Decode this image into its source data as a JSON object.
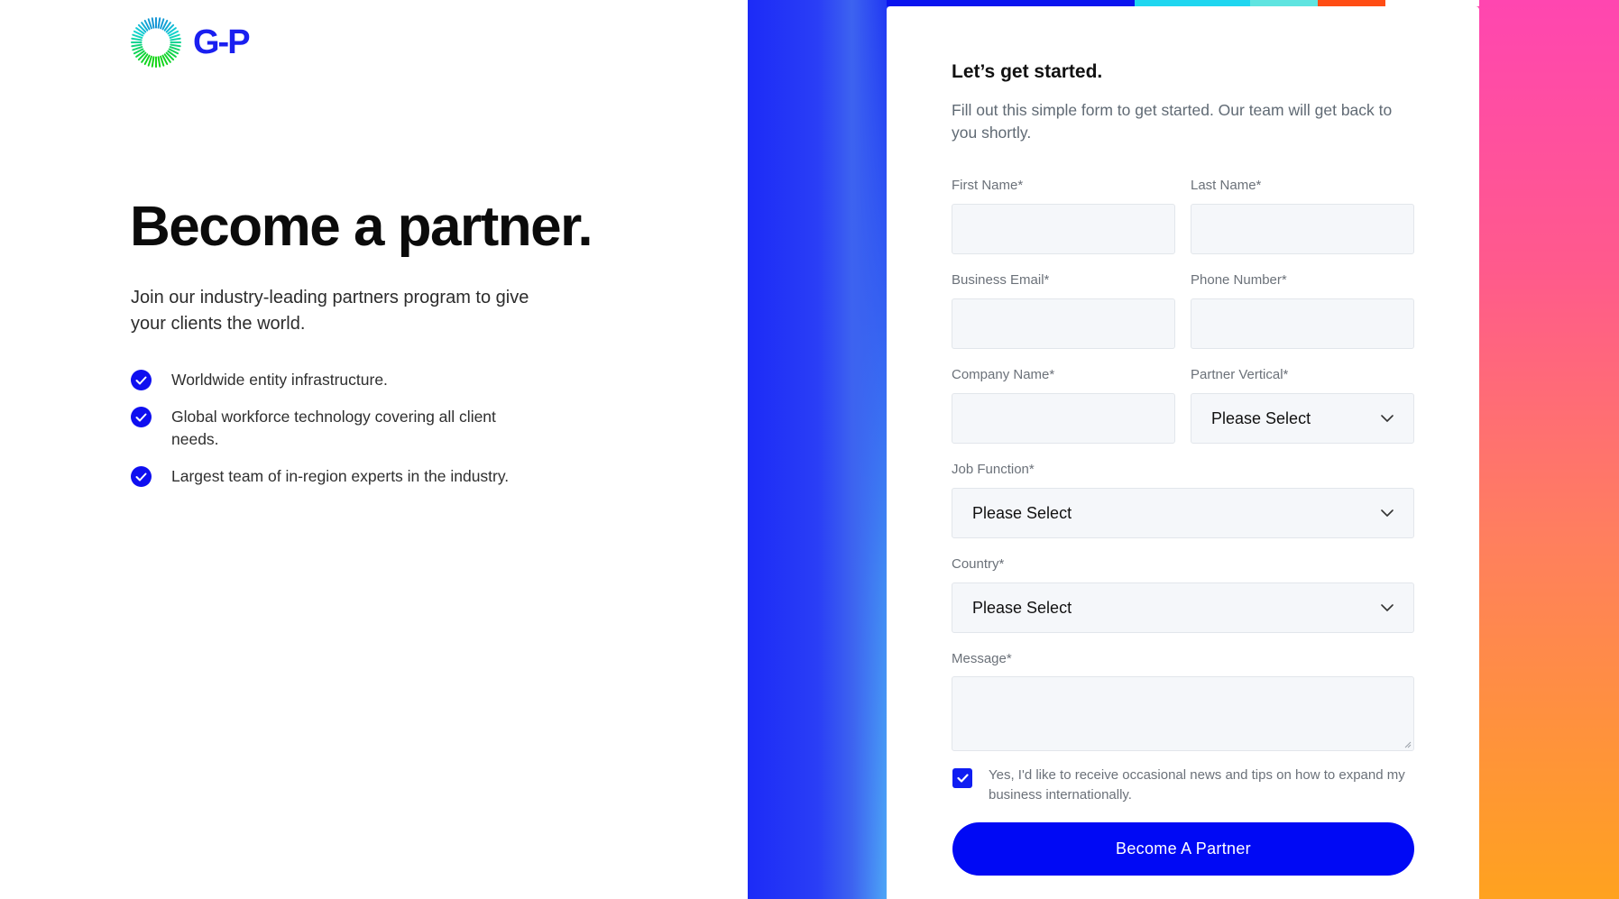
{
  "brand": {
    "logo_text": "G-P",
    "accent_color": "#0f0ff0",
    "button_color": "#0009f5"
  },
  "hero": {
    "headline": "Become a partner.",
    "intro": "Join our industry-leading partners program to give your clients the world.",
    "benefits": [
      "Worldwide entity infrastructure.",
      "Global workforce technology covering all client needs.",
      "Largest team of in-region experts in the industry."
    ]
  },
  "form": {
    "title": "Let’s get started.",
    "subtitle": "Fill out this simple form to get started. Our team will get back to you shortly.",
    "first_name": {
      "label": "First Name*",
      "value": ""
    },
    "last_name": {
      "label": "Last Name*",
      "value": ""
    },
    "business_email": {
      "label": "Business Email*",
      "value": ""
    },
    "phone_number": {
      "label": "Phone Number*",
      "value": ""
    },
    "company_name": {
      "label": "Company Name*",
      "value": ""
    },
    "partner_vertical": {
      "label": "Partner Vertical*",
      "selected": "Please Select"
    },
    "job_function": {
      "label": "Job Function*",
      "selected": "Please Select"
    },
    "country": {
      "label": "Country*",
      "selected": "Please Select"
    },
    "message": {
      "label": "Message*",
      "value": ""
    },
    "consent": {
      "checked": true,
      "text": "Yes, I'd like to receive occasional news and tips on how to expand my business internationally."
    },
    "submit_label": "Become A Partner"
  },
  "decor": {
    "strip_colors": [
      "#0a14ef",
      "#1fd6f0",
      "#5fe4e0",
      "#ff4d14",
      "#ffffff"
    ]
  }
}
